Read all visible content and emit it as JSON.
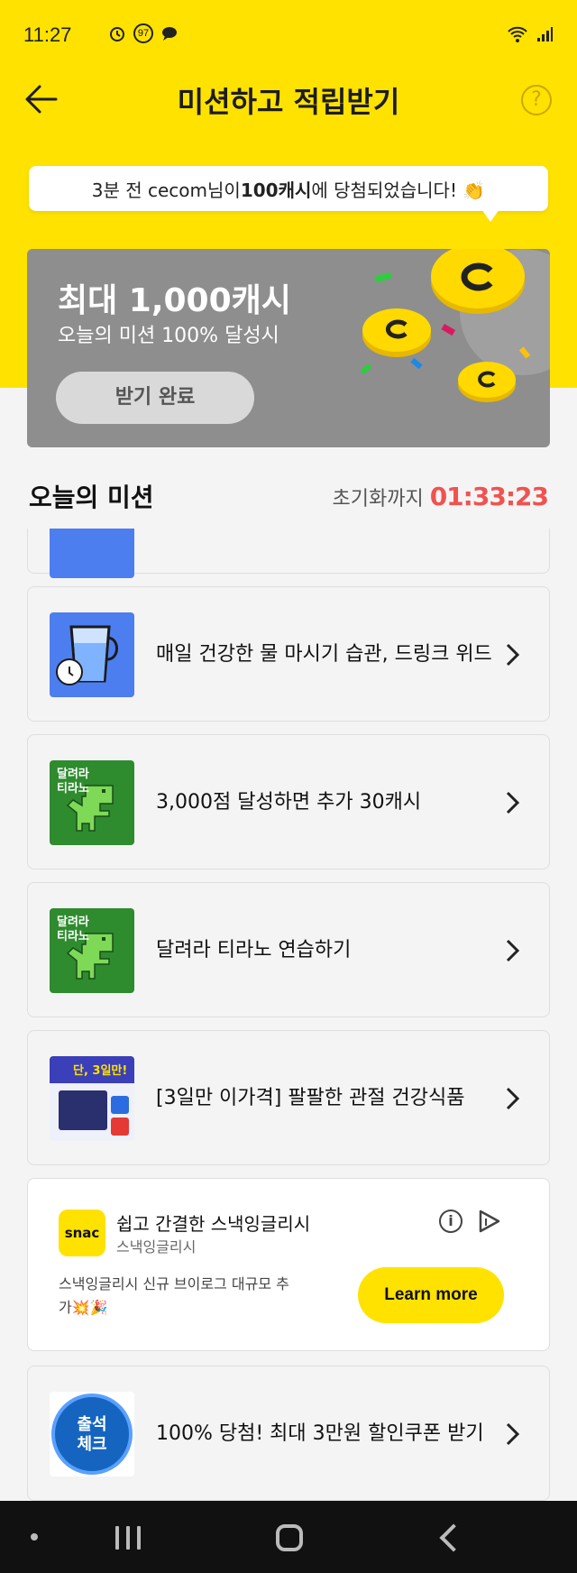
{
  "status_bar": {
    "time": "11:27",
    "badge": "97"
  },
  "header": {
    "title": "미션하고 적립받기",
    "help_label": "?"
  },
  "notification": {
    "prefix": "3분 전 cecom님이 ",
    "amount": "100캐시",
    "suffix": "에 당첨되었습니다! 👏"
  },
  "reward": {
    "title": "최대 1,000캐시",
    "subtitle": "오늘의 미션 100% 달성시",
    "button_label": "받기 완료"
  },
  "missions_section": {
    "title": "오늘의 미션",
    "reset_label": "초기화까지",
    "reset_timer": "01:33:23"
  },
  "missions": [
    {
      "label": "매일 건강한 물 마시기 습관, 드링크 위드",
      "thumb": "water-cup-icon"
    },
    {
      "label": "3,000점 달성하면 추가 30캐시",
      "thumb": "dino-game",
      "thumb_text": "달려라 티라노"
    },
    {
      "label": "달려라 티라노 연습하기",
      "thumb": "dino-game",
      "thumb_text": "달려라 티라노"
    },
    {
      "label": "[3일만 이가격] 팔팔한 관절 건강식품",
      "thumb": "product-promo",
      "thumb_text": "단, 3일만!"
    },
    {
      "label": "100% 당첨! 최대 3만원 할인쿠폰 받기",
      "thumb": "attendance-check",
      "thumb_text": "출석 체크"
    }
  ],
  "ad": {
    "logo_text": "snac",
    "title": "쉽고 간결한 스낵잉글리시",
    "brand": "스낵잉글리시",
    "description": "스낵잉글리시 신규 브이로그 대규모 추가💥🎉",
    "cta": "Learn more"
  },
  "colors": {
    "brand_yellow": "#ffe200",
    "timer_red": "#ef5350",
    "reward_gray": "#8e8e8e"
  }
}
